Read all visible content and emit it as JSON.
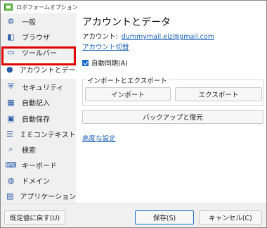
{
  "window": {
    "title": "ロボフォームオプション"
  },
  "sidebar": {
    "items": [
      {
        "label": "一般",
        "icon": "gear-icon",
        "glyph": "⚙"
      },
      {
        "label": "ブラウザ",
        "icon": "browser-icon",
        "glyph": "◧"
      },
      {
        "label": "ツールバー",
        "icon": "toolbar-icon",
        "glyph": "▭"
      },
      {
        "label": "アカウントとデータ",
        "icon": "user-icon",
        "glyph": "●"
      },
      {
        "label": "セキュリティ",
        "icon": "shield-icon",
        "glyph": "⛨"
      },
      {
        "label": "自動記入",
        "icon": "autofill-icon",
        "glyph": "▦"
      },
      {
        "label": "自動保存",
        "icon": "save-icon",
        "glyph": "▣"
      },
      {
        "label": "ＩＥコンテキストメニ",
        "icon": "context-menu-icon",
        "glyph": "☰"
      },
      {
        "label": "検索",
        "icon": "search-icon",
        "glyph": "⌕"
      },
      {
        "label": "キーボード",
        "icon": "keyboard-icon",
        "glyph": "⌨"
      },
      {
        "label": "ドメイン",
        "icon": "globe-icon",
        "glyph": "◍"
      },
      {
        "label": "アプリケーション",
        "icon": "app-icon",
        "glyph": "▤"
      }
    ],
    "selected_index": 3
  },
  "main": {
    "title": "アカウントとデータ",
    "account_label": "アカウント:",
    "account_email": "dummymail.eiz@gmail.com",
    "switch_account": "アカウント切替",
    "auto_sync_label": "自動同期(A)",
    "auto_sync_checked": true,
    "import_export_title": "インポートとエクスポート",
    "import_button": "インポート",
    "export_button": "エクスポート",
    "backup_restore_button": "バックアップと復元",
    "advanced_link": "高度な設定"
  },
  "footer": {
    "reset_button": "既定値に戻す(U)",
    "save_button": "保存(S)",
    "cancel_button": "キャンセル(C)"
  },
  "colors": {
    "accent": "#1d6fc9",
    "link": "#1a5fb4",
    "highlight_border": "#e00000"
  }
}
